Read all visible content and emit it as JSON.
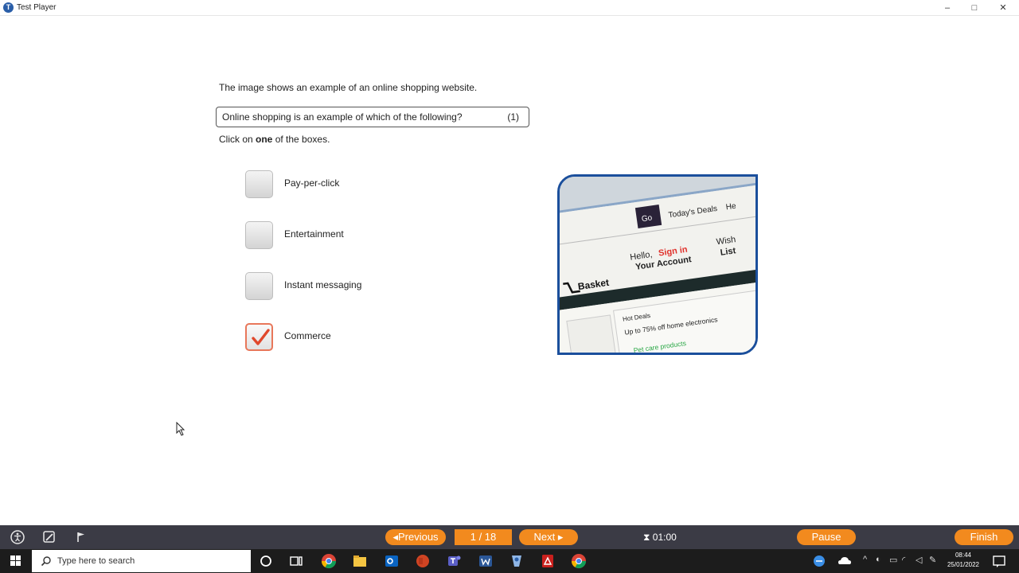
{
  "window": {
    "title": "Test Player",
    "minimize": "–",
    "maximize": "□",
    "close": "✕"
  },
  "question": {
    "stem": "The image shows an example of an online shopping website.",
    "text": "Online shopping is an example of which of the following?",
    "marks": "(1)",
    "instruction_pre": "Click on ",
    "instruction_bold": "one",
    "instruction_post": " of the boxes.",
    "options": [
      {
        "label": "Pay-per-click",
        "checked": false
      },
      {
        "label": "Entertainment",
        "checked": false
      },
      {
        "label": "Instant messaging",
        "checked": false
      },
      {
        "label": "Commerce",
        "checked": true
      }
    ]
  },
  "shop_image": {
    "go": "Go",
    "todays_deals": "Today's Deals",
    "he": "He",
    "hello": "Hello,",
    "sign_in": "Sign in",
    "your_account": "Your Account",
    "wish": "Wish",
    "list": "List",
    "basket": "Basket",
    "hot_deals": "Hot Deals",
    "offer": "Up to 75% off home electronics",
    "pet_care": "Pet care products",
    "colors": {
      "frame": "#1b4f9c",
      "sign_in": "#e0312b",
      "dark_band": "#1d2b2b",
      "green": "#29a745"
    }
  },
  "player": {
    "previous": "Previous",
    "page": "1 / 18",
    "next": "Next",
    "timer": "01:00",
    "pause": "Pause",
    "finish": "Finish",
    "accent": "#f28a1e"
  },
  "taskbar": {
    "search_placeholder": "Type here to search",
    "time": "08:44",
    "date": "25/01/2022",
    "apps": [
      "chrome-icon",
      "file-explorer-icon",
      "outlook-icon",
      "powerpoint-icon",
      "teams-icon",
      "word-icon",
      "test-player-icon",
      "acrobat-icon",
      "chrome-icon"
    ]
  }
}
